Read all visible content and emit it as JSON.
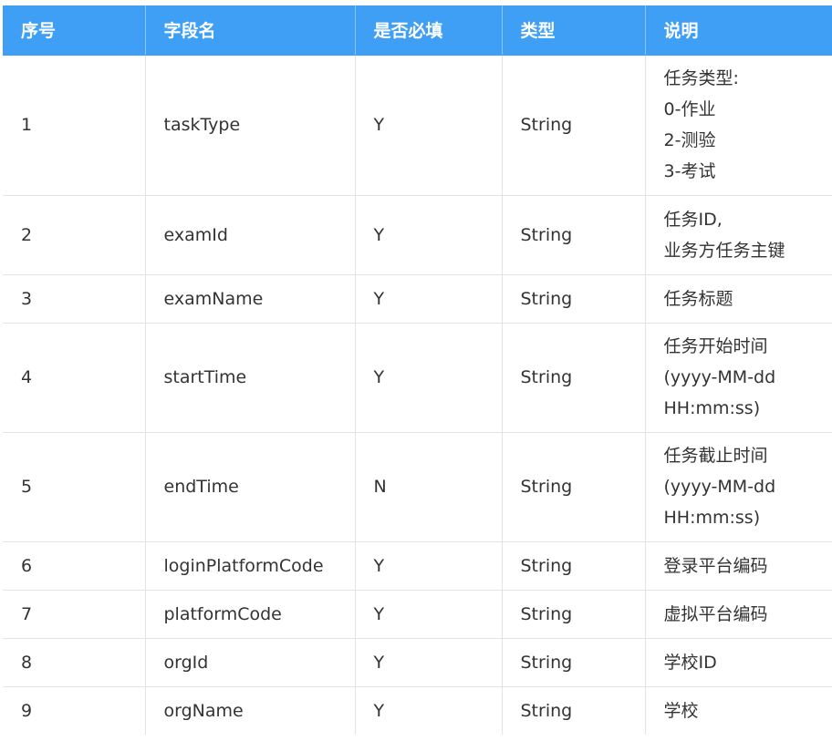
{
  "headers": [
    "序号",
    "字段名",
    "是否必填",
    "类型",
    "说明"
  ],
  "rows": [
    {
      "no": "1",
      "field": "taskType",
      "required": "Y",
      "type": "String",
      "desc": [
        "任务类型:",
        "0-作业",
        "2-测验",
        "3-考试"
      ]
    },
    {
      "no": "2",
      "field": "examId",
      "required": "Y",
      "type": "String",
      "desc": [
        "任务ID,",
        "业务方任务主键"
      ]
    },
    {
      "no": "3",
      "field": "examName",
      "required": "Y",
      "type": "String",
      "desc": [
        "任务标题"
      ]
    },
    {
      "no": "4",
      "field": "startTime",
      "required": "Y",
      "type": "String",
      "desc": [
        "任务开始时间",
        "(yyyy-MM-dd",
        "HH:mm:ss)"
      ]
    },
    {
      "no": "5",
      "field": "endTime",
      "required": "N",
      "type": "String",
      "desc": [
        "任务截止时间",
        "(yyyy-MM-dd",
        "HH:mm:ss)"
      ]
    },
    {
      "no": "6",
      "field": "loginPlatformCode",
      "required": "Y",
      "type": "String",
      "desc": [
        "登录平台编码"
      ]
    },
    {
      "no": "7",
      "field": "platformCode",
      "required": "Y",
      "type": "String",
      "desc": [
        "虚拟平台编码"
      ]
    },
    {
      "no": "8",
      "field": "orgId",
      "required": "Y",
      "type": "String",
      "desc": [
        "学校ID"
      ]
    },
    {
      "no": "9",
      "field": "orgName",
      "required": "Y",
      "type": "String",
      "desc": [
        "学校"
      ]
    }
  ]
}
